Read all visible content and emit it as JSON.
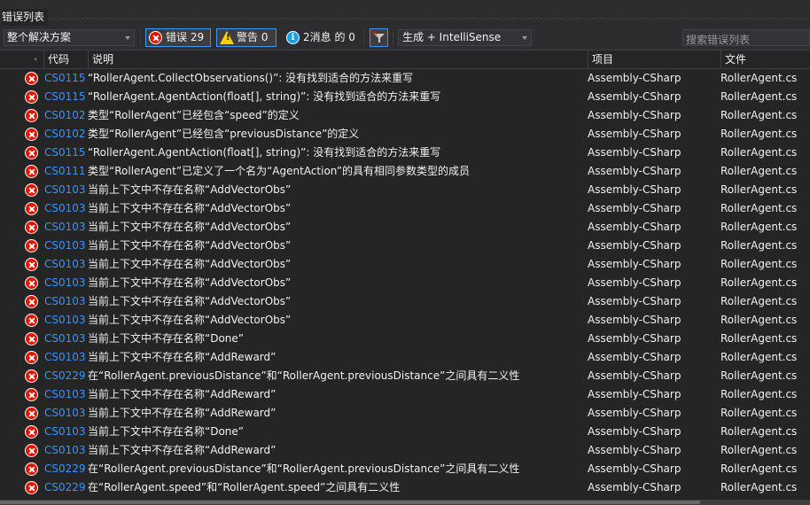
{
  "panel": {
    "title": "错误列表"
  },
  "toolbar": {
    "scope": "整个解决方案",
    "errors_label": "错误 29",
    "warnings_label": "警告 0",
    "messages_label": "2消息 的 0",
    "build_filter": "生成 + IntelliSense",
    "search_placeholder": "搜索错误列表"
  },
  "columns": {
    "code": "代码",
    "description": "说明",
    "project": "项目",
    "file": "文件"
  },
  "rows": [
    {
      "code": "CS0115",
      "desc": "“RollerAgent.CollectObservations()”: 没有找到适合的方法来重写",
      "project": "Assembly-CSharp",
      "file": "RollerAgent.cs"
    },
    {
      "code": "CS0115",
      "desc": "“RollerAgent.AgentAction(float[], string)”: 没有找到适合的方法来重写",
      "project": "Assembly-CSharp",
      "file": "RollerAgent.cs"
    },
    {
      "code": "CS0102",
      "desc": "类型“RollerAgent”已经包含“speed”的定义",
      "project": "Assembly-CSharp",
      "file": "RollerAgent.cs"
    },
    {
      "code": "CS0102",
      "desc": "类型“RollerAgent”已经包含“previousDistance”的定义",
      "project": "Assembly-CSharp",
      "file": "RollerAgent.cs"
    },
    {
      "code": "CS0115",
      "desc": "“RollerAgent.AgentAction(float[], string)”: 没有找到适合的方法来重写",
      "project": "Assembly-CSharp",
      "file": "RollerAgent.cs"
    },
    {
      "code": "CS0111",
      "desc": "类型“RollerAgent”已定义了一个名为“AgentAction”的具有相同参数类型的成员",
      "project": "Assembly-CSharp",
      "file": "RollerAgent.cs"
    },
    {
      "code": "CS0103",
      "desc": "当前上下文中不存在名称“AddVectorObs”",
      "project": "Assembly-CSharp",
      "file": "RollerAgent.cs"
    },
    {
      "code": "CS0103",
      "desc": "当前上下文中不存在名称“AddVectorObs”",
      "project": "Assembly-CSharp",
      "file": "RollerAgent.cs"
    },
    {
      "code": "CS0103",
      "desc": "当前上下文中不存在名称“AddVectorObs”",
      "project": "Assembly-CSharp",
      "file": "RollerAgent.cs"
    },
    {
      "code": "CS0103",
      "desc": "当前上下文中不存在名称“AddVectorObs”",
      "project": "Assembly-CSharp",
      "file": "RollerAgent.cs"
    },
    {
      "code": "CS0103",
      "desc": "当前上下文中不存在名称“AddVectorObs”",
      "project": "Assembly-CSharp",
      "file": "RollerAgent.cs"
    },
    {
      "code": "CS0103",
      "desc": "当前上下文中不存在名称“AddVectorObs”",
      "project": "Assembly-CSharp",
      "file": "RollerAgent.cs"
    },
    {
      "code": "CS0103",
      "desc": "当前上下文中不存在名称“AddVectorObs”",
      "project": "Assembly-CSharp",
      "file": "RollerAgent.cs"
    },
    {
      "code": "CS0103",
      "desc": "当前上下文中不存在名称“AddVectorObs”",
      "project": "Assembly-CSharp",
      "file": "RollerAgent.cs"
    },
    {
      "code": "CS0103",
      "desc": "当前上下文中不存在名称“Done”",
      "project": "Assembly-CSharp",
      "file": "RollerAgent.cs"
    },
    {
      "code": "CS0103",
      "desc": "当前上下文中不存在名称“AddReward”",
      "project": "Assembly-CSharp",
      "file": "RollerAgent.cs"
    },
    {
      "code": "CS0229",
      "desc": "在“RollerAgent.previousDistance”和“RollerAgent.previousDistance”之间具有二义性",
      "project": "Assembly-CSharp",
      "file": "RollerAgent.cs"
    },
    {
      "code": "CS0103",
      "desc": "当前上下文中不存在名称“AddReward”",
      "project": "Assembly-CSharp",
      "file": "RollerAgent.cs"
    },
    {
      "code": "CS0103",
      "desc": "当前上下文中不存在名称“AddReward”",
      "project": "Assembly-CSharp",
      "file": "RollerAgent.cs"
    },
    {
      "code": "CS0103",
      "desc": "当前上下文中不存在名称“Done”",
      "project": "Assembly-CSharp",
      "file": "RollerAgent.cs"
    },
    {
      "code": "CS0103",
      "desc": "当前上下文中不存在名称“AddReward”",
      "project": "Assembly-CSharp",
      "file": "RollerAgent.cs"
    },
    {
      "code": "CS0229",
      "desc": "在“RollerAgent.previousDistance”和“RollerAgent.previousDistance”之间具有二义性",
      "project": "Assembly-CSharp",
      "file": "RollerAgent.cs"
    },
    {
      "code": "CS0229",
      "desc": "在“RollerAgent.speed”和“RollerAgent.speed”之间具有二义性",
      "project": "Assembly-CSharp",
      "file": "RollerAgent.cs"
    }
  ],
  "icons": {
    "row": "error-icon",
    "errors": "error-icon",
    "warnings": "warning-icon",
    "messages": "info-icon",
    "filter": "clear-filter-icon"
  },
  "colors": {
    "error": "#e51400",
    "warning": "#ffcc00",
    "info": "#1ba1e2",
    "code_link": "#3794ff",
    "accent": "#3399ff"
  }
}
